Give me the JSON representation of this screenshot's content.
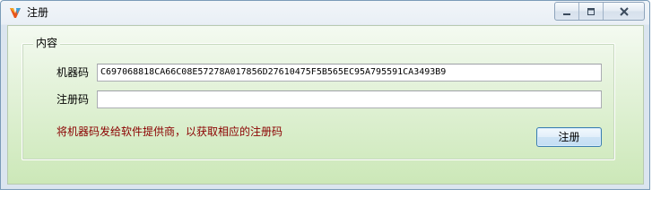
{
  "window": {
    "title": "注册",
    "icon": "app-logo-icon",
    "caption_buttons": [
      "minimize-icon",
      "maximize-icon",
      "close-icon"
    ]
  },
  "group": {
    "label": "内容"
  },
  "form": {
    "machine_code_label": "机器码",
    "machine_code_value": "C697068818CA66C08E57278A017856D27610475F5B565EC95A795591CA3493B9",
    "reg_code_label": "注册码",
    "reg_code_value": ""
  },
  "hint": {
    "text": "将机器码发给软件提供商，以获取相应的注册码",
    "color": "#8b0000"
  },
  "actions": {
    "register_label": "注册"
  }
}
